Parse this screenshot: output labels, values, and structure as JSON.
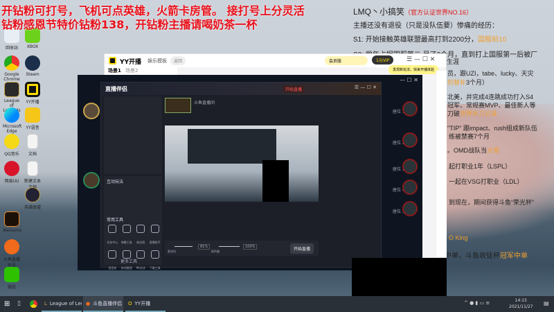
{
  "promo": {
    "line1": "开钻粉可打号，飞机可点英雄，火箭卡房管。 接打号上分灵活",
    "line2": "钻粉感恩节特价钻粉138，开钻粉主播请喝奶茶一杯"
  },
  "bio": {
    "title": "LMQ丶小搞笑",
    "title_badge": "（官方认证世界NO.16）",
    "intro": "主播还没有退役（只是没队伍要）惨痛的经历：",
    "s1": "S1:  开始接触英雄联盟最高打到2200分，",
    "s1_hl": "国服前10",
    "s2": "S2:  常年占据国服第二 呆了3个月，直到打上国服第一后被厂",
    "l3": "生涯",
    "l4": "员，跟UZI，tabe、lucky、天灾",
    "l5_hl": "的替补",
    "l5": "3个月）",
    "l6": "北美，并完成4连跳成功打入S4",
    "l7": "冠军、常规赛MVP、最佳新人等",
    "l8": "刀破",
    "l8_hl": "世界补刀记录",
    "l9": "\"TIP\" 跟impact、rush组成新队伍",
    "l10": "练被禁赛7个月",
    "l11": "。OMD战队当",
    "l11_hl": "大哥",
    "l12": "起打职业1年（LSPL）",
    "l13": "一起在VSG打职业（LDL）",
    "l14": "到现在，期间获得斗鱼“荣光杯”",
    "l15": "O King",
    "l16": "杯亚军中单，斗鱼收徒杯",
    "l16_hl": "冠军中单"
  },
  "desktop_icons": [
    "回收站",
    "XBOX",
    "Google Chrome",
    "Steam",
    "League of Legends",
    "YY开播",
    "Microsoft Edge",
    "YY语音",
    "QQ音乐",
    "文档",
    "网易UU",
    "新建文本文档",
    "WeGame",
    "英雄联盟",
    "斗鱼直播伴侣",
    "微信"
  ],
  "yy": {
    "app": "YY开播",
    "section": "娱乐模板",
    "back": "返回",
    "scene1": "场景1",
    "scene2": "场景2",
    "member": "会员版",
    "tooltip": "发现新玩法，快来开播体验",
    "vip": "1元VIP"
  },
  "studio": {
    "title": "直播伴侣",
    "start_btn": "开始直播",
    "room": "斗鱼直播间",
    "plays_title": "互动玩法",
    "tools_title": "常用工具",
    "tools": [
      "任务中心",
      "弹幕工具",
      "粉丝群",
      "直播助手",
      "语音房",
      "房间管理",
      "PK对决",
      "下载工具"
    ],
    "mic": "麦克风",
    "mic_val": "81%",
    "spk": "扬声器",
    "spk_val": "100%",
    "go_live": "开始直播",
    "more": "更多工具",
    "seats": [
      "座位 1",
      "座位 2",
      "座位 3",
      "座位 4",
      "座位 5"
    ]
  },
  "taskbar": {
    "items": [
      "League of Legends",
      "斗鱼直播伴侣",
      "YY开播"
    ],
    "time": "14:15",
    "date": "2021/11/27"
  },
  "colors": {
    "promo": "#e8101a",
    "highlight": "#f0a030",
    "accent": "#ffd000"
  }
}
